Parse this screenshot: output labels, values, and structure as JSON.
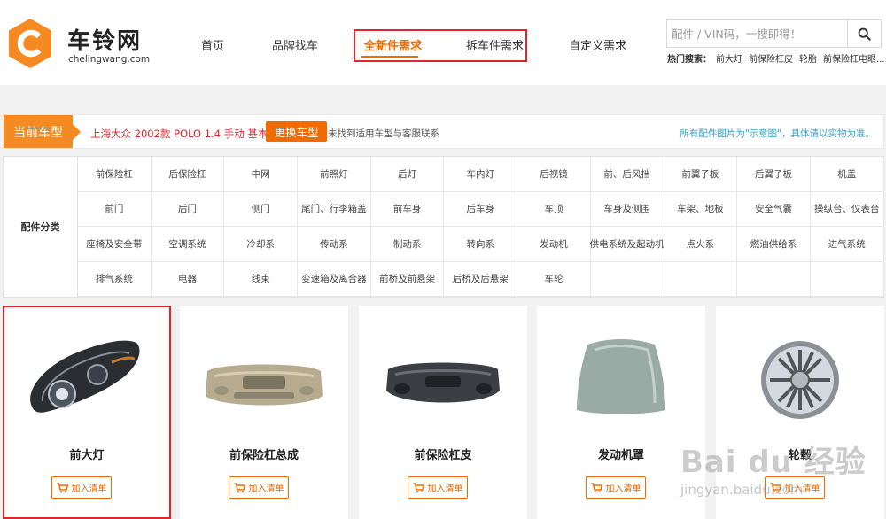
{
  "brand": {
    "name": "车铃网",
    "domain": "chelingwang.com",
    "color": "#f58a22"
  },
  "nav": {
    "items": [
      "首页",
      "品牌找车",
      "全新件需求",
      "拆车件需求",
      "自定义需求"
    ],
    "active": "全新件需求"
  },
  "search": {
    "placeholder": "配件 / VIN码，一搜即得！",
    "hot_label": "热门搜索：",
    "hot_keywords": [
      "前大灯",
      "前保险杠皮",
      "轮胎",
      "前保险杠电眼..."
    ]
  },
  "current_vehicle": {
    "label": "当前车型",
    "model": "上海大众 2002款 POLO 1.4 手动 基本版",
    "change_button": "更换车型",
    "hint": "未找到适用车型与客服联系",
    "note": "所有配件图片为\"示意图\"，具体请以实物为准。"
  },
  "categories": {
    "title": "配件分类",
    "items": [
      "前保险杠",
      "后保险杠",
      "中网",
      "前照灯",
      "后灯",
      "车内灯",
      "后视镜",
      "前、后风挡",
      "前翼子板",
      "后翼子板",
      "机盖",
      "前门",
      "后门",
      "侧门",
      "尾门、行李箱盖",
      "前车身",
      "后车身",
      "车顶",
      "车身及侧围",
      "车架、地板",
      "安全气囊",
      "操纵台、仪表台",
      "座椅及安全带",
      "空调系统",
      "冷却系",
      "传动系",
      "制动系",
      "转向系",
      "发动机",
      "供电系统及起动机",
      "点火系",
      "燃油供给系",
      "进气系统",
      "排气系统",
      "电器",
      "线束",
      "变速箱及离合器",
      "前桥及前悬架",
      "后桥及后悬架",
      "车轮",
      "",
      "",
      "",
      ""
    ]
  },
  "products": [
    {
      "name": "前大灯",
      "add_label": "加入清单",
      "icon": "headlight"
    },
    {
      "name": "前保险杠总成",
      "add_label": "加入清单",
      "icon": "bumper-assembly"
    },
    {
      "name": "前保险杠皮",
      "add_label": "加入清单",
      "icon": "bumper-skin"
    },
    {
      "name": "发动机罩",
      "add_label": "加入清单",
      "icon": "hood"
    },
    {
      "name": "轮毂",
      "add_label": "加入清单",
      "icon": "wheel"
    }
  ],
  "watermark": {
    "text": "Bai du 经验",
    "sub": "jingyan.baidu.com"
  }
}
